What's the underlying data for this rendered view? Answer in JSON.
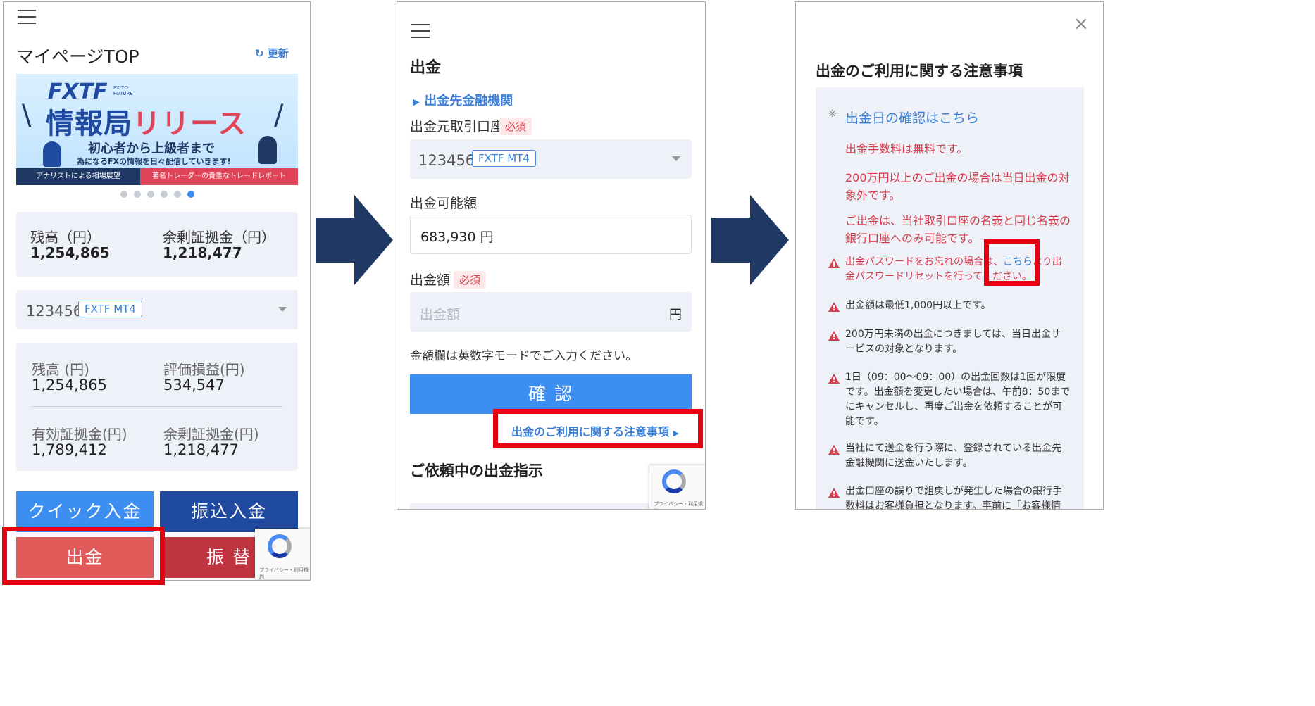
{
  "screen1": {
    "title": "マイページTOP",
    "refresh_label": "更新",
    "banner": {
      "logo": "FXTF",
      "logo_small": "FX TO FUTURE",
      "headline": "情報局リリース",
      "sub1": "初心者から上級者まで",
      "sub2": "為になるFXの情報を日々配信していきます!",
      "footer_left": "アナリストによる相場展望",
      "footer_right": "著名トレーダーの貴重なトレードレポート"
    },
    "summary": {
      "balance_label": "残高（円）",
      "balance_value": "1,254,865",
      "margin_label": "余剰証拠金（円）",
      "margin_value": "1,218,477"
    },
    "account": {
      "number": "123456",
      "badge": "FXTF MT4"
    },
    "details": {
      "balance_label": "残高 (円)",
      "balance_value": "1,254,865",
      "pl_label": "評価損益(円)",
      "pl_value": "534,547",
      "eff_margin_label": "有効証拠金(円)",
      "eff_margin_value": "1,789,412",
      "free_margin_label": "余剰証拠金(円)",
      "free_margin_value": "1,218,477"
    },
    "buttons": {
      "quick_deposit": "クイック入金",
      "transfer_deposit": "振込入金",
      "withdraw": "出金",
      "transfer": "振 替"
    },
    "recaptcha_text": "プライバシー・利用規約"
  },
  "screen2": {
    "title": "出金",
    "bank_link": "出金先金融機関",
    "source_label": "出金元取引口座",
    "required": "必須",
    "account": {
      "number": "123456",
      "badge": "FXTF MT4"
    },
    "available_label": "出金可能額",
    "available_value": "683,930 円",
    "amount_label": "出金額",
    "amount_placeholder": "出金額",
    "amount_unit": "円",
    "hint": "金額欄は英数字モードでご入力ください。",
    "confirm_button": "確 認",
    "notes_link": "出金のご利用に関する注意事項",
    "pending_title": "ご依頼中の出金指示",
    "recaptcha_text": "プライバシー・利用規約"
  },
  "screen3": {
    "title": "出金のご利用に関する注意事項",
    "close": "×",
    "asterisk": "※",
    "date_link": "出金日の確認はこちら",
    "notice1": "出金手数料は無料です。",
    "notice2": "200万円以上のご出金の場合は当日出金の対象外です。",
    "notice3": "ご出金は、当社取引口座の名義と同じ名義の銀行口座へのみ可能です。",
    "warn1_before": "出金パスワードをお忘れの場合は、",
    "warn1_link": "こちら",
    "warn1_after": "より出金パスワードリセットを行ってください。",
    "warn2": "出金額は最低1,000円以上です。",
    "warn3": "200万円未満の出金につきましては、当日出金サービスの対象となります。",
    "warn4": "1日（09：00〜09：00）の出金回数は1回が限度です。出金額を変更したい場合は、午前8：50までにキャンセルし、再度ご出金を依頼することが可能です。",
    "warn5": "当社にて送金を行う際に、登録されている出金先金融機関に送金いたします。",
    "warn6": "出金口座の誤りで組戻しが発生した場合の銀行手数料はお客様負担となります。事前に「お客様情報」"
  },
  "colors": {
    "navy": "#1f3864",
    "blue_button": "#3c8ff0",
    "dark_blue_button": "#1f4aa0",
    "withdraw_red": "#e05a5a",
    "transfer_red": "#c0343f",
    "highlight": "#e60012",
    "link_blue": "#3b7fd4"
  }
}
